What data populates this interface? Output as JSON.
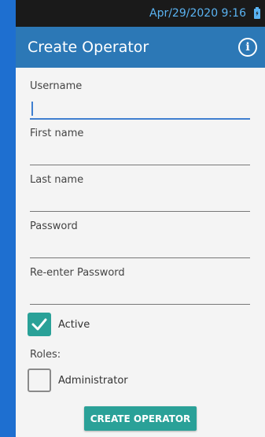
{
  "status_bar": {
    "datetime": "Apr/29/2020 9:16",
    "icons": [
      "battery-charging-icon"
    ]
  },
  "app_bar": {
    "title": "Create Operator",
    "icons": [
      "info-icon"
    ]
  },
  "form": {
    "username": {
      "label": "Username",
      "value": ""
    },
    "first_name": {
      "label": "First name",
      "value": ""
    },
    "last_name": {
      "label": "Last name",
      "value": ""
    },
    "password": {
      "label": "Password",
      "value": ""
    },
    "reenter_password": {
      "label": "Re-enter Password",
      "value": ""
    },
    "active": {
      "label": "Active",
      "checked": true
    },
    "roles_label": "Roles:",
    "roles": [
      {
        "label": "Administrator",
        "checked": false
      }
    ],
    "submit_label": "CREATE OPERATOR"
  },
  "colors": {
    "app_bar": "#2c78b6",
    "accent": "#2aa198",
    "focus": "#3f7fd0",
    "status_text": "#5ab3f2"
  }
}
